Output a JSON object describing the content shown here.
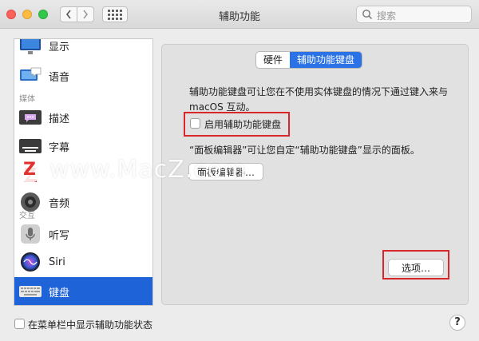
{
  "window": {
    "title": "辅助功能"
  },
  "search": {
    "placeholder": "搜索"
  },
  "sidebar": {
    "items": [
      {
        "label": "显示",
        "icon": "display-icon"
      },
      {
        "label": "语音",
        "icon": "speech-icon"
      },
      {
        "section": "媒体"
      },
      {
        "label": "描述",
        "icon": "descriptions-icon"
      },
      {
        "label": "字幕",
        "icon": "captions-icon"
      },
      {
        "label": "",
        "icon": "audio-z-icon"
      },
      {
        "label": "音频",
        "icon": "speaker-icon"
      },
      {
        "section": "交互"
      },
      {
        "label": "听写",
        "icon": "microphone-icon"
      },
      {
        "label": "Siri",
        "icon": "siri-icon"
      },
      {
        "label": "键盘",
        "icon": "keyboard-icon",
        "selected": true
      }
    ]
  },
  "tabs": [
    {
      "label": "硬件",
      "active": false
    },
    {
      "label": "辅助功能键盘",
      "active": true
    }
  ],
  "content": {
    "description": "辅助功能键盘可让您在不使用实体键盘的情况下通过键入来与 macOS 互动。",
    "enable_checkbox_label": "启用辅助功能键盘",
    "enable_checked": false,
    "panel_editor_desc": "“面板编辑器”可让您自定“辅助功能键盘”显示的面板。",
    "panel_editor_button": "面板编辑器…",
    "options_button": "选项…"
  },
  "footer": {
    "menu_bar_checkbox_label": "在菜单栏中显示辅助功能状态",
    "menu_bar_checked": false,
    "help_label": "?"
  },
  "watermark": {
    "logo": "Z",
    "text": "www.MacZ.com"
  },
  "colors": {
    "selection": "#1f63d8",
    "active_tab": "#2a72e6",
    "highlight_box": "#d9262a"
  }
}
